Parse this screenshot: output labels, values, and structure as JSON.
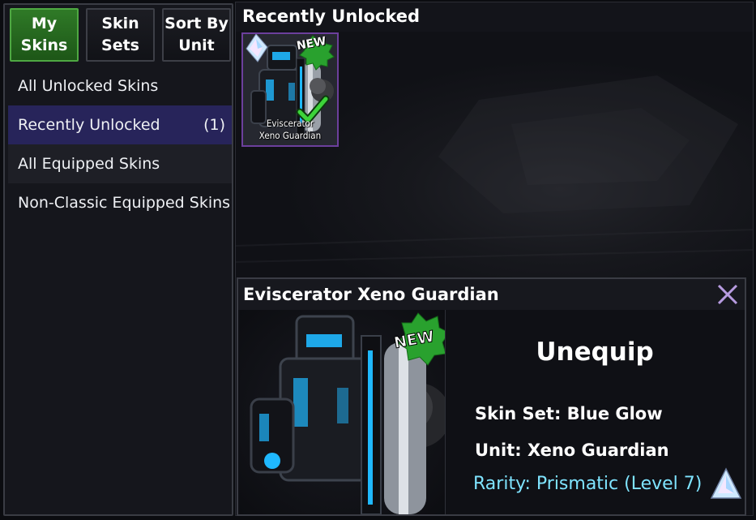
{
  "tabs": [
    {
      "label": "My\nSkins",
      "active": true
    },
    {
      "label": "Skin\nSets",
      "active": false
    },
    {
      "label": "Sort By\nUnit",
      "active": false
    }
  ],
  "sidebar": {
    "items": [
      {
        "label": "All Unlocked Skins",
        "count": ""
      },
      {
        "label": "Recently Unlocked",
        "count": "(1)"
      },
      {
        "label": "All Equipped Skins",
        "count": ""
      },
      {
        "label": "Non-Classic Equipped Skins",
        "count": ""
      }
    ]
  },
  "main": {
    "title": "Recently Unlocked",
    "card": {
      "name": "Eviscerator\nXeno Guardian",
      "badge": "NEW",
      "rarity_icon": "prismatic-gem-icon",
      "status_icon": "checkmark-icon"
    }
  },
  "detail": {
    "title": "Eviscerator Xeno Guardian",
    "badge": "NEW",
    "action": "Unequip",
    "skin_set": "Skin Set: Blue Glow",
    "unit": "Unit: Xeno Guardian",
    "rarity": "Rarity: Prismatic (Level 7)",
    "rarity_icon": "prismatic-gem-icon",
    "close_icon": "close-x-icon"
  },
  "colors": {
    "active_tab": "#2f7a27",
    "selected_item": "#27245a",
    "card_border": "#6c3f9c",
    "rarity_text": "#7fe4ff",
    "accent_glow": "#1fb8ff"
  }
}
